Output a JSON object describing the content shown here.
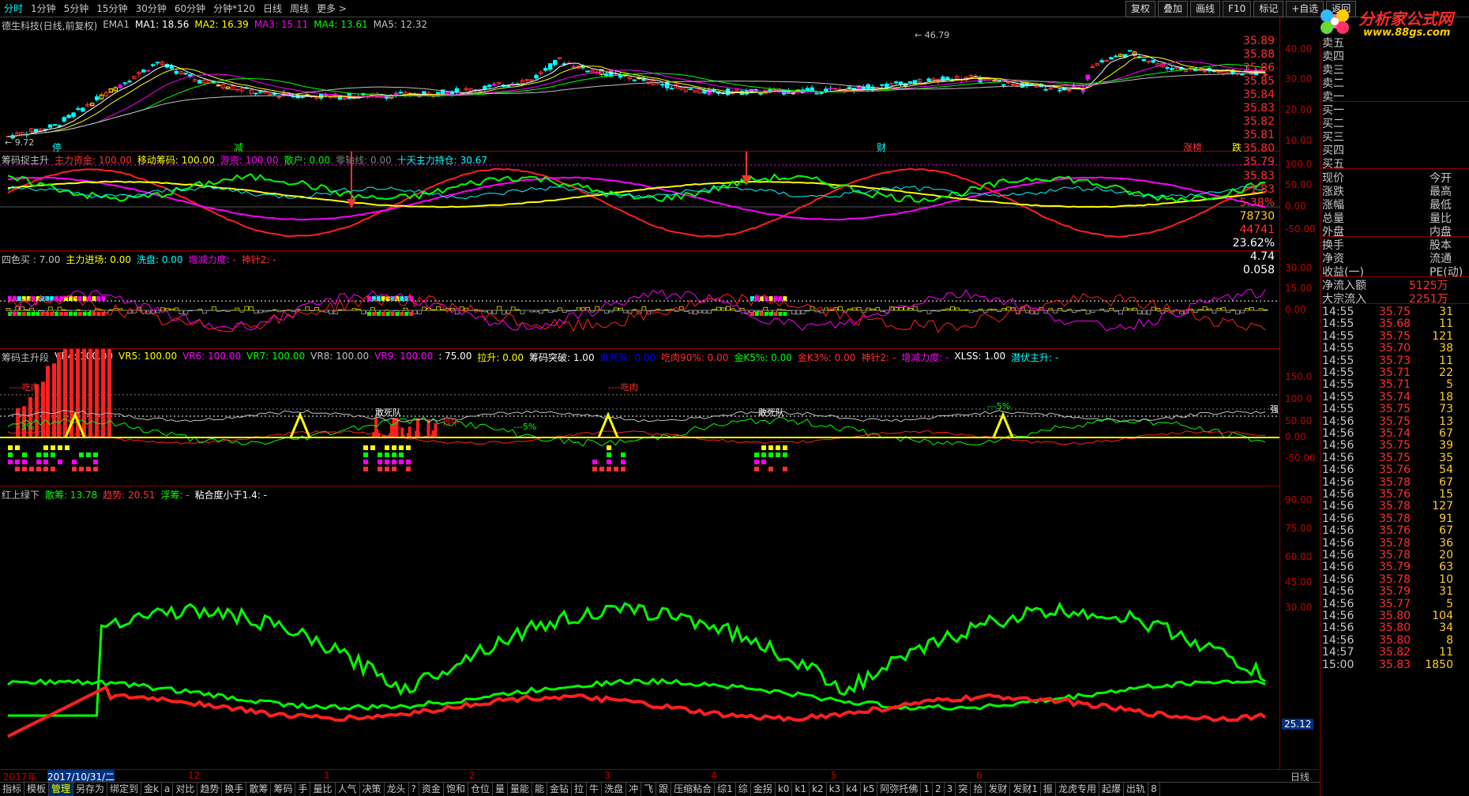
{
  "toolbar": {
    "timeframes": [
      "分时",
      "1分钟",
      "5分钟",
      "15分钟",
      "30分钟",
      "60分钟",
      "分钟*120",
      "日线",
      "周线",
      "更多 >"
    ],
    "buttons": [
      "复权",
      "叠加",
      "画线",
      "F10",
      "标记",
      "+自选",
      "返回"
    ]
  },
  "logo": {
    "text": "分析家公式网",
    "url": "www.88gs.com"
  },
  "pane1": {
    "title": "德生科技(日线,前复权)",
    "items": [
      {
        "t": "EMA1",
        "c": "#c0c0c0"
      },
      {
        "t": "MA1: 18.56",
        "c": "#ffffff"
      },
      {
        "t": "MA2: 16.39",
        "c": "#ffff00"
      },
      {
        "t": "MA3: 15.11",
        "c": "#ff00ff"
      },
      {
        "t": "MA4: 13.61",
        "c": "#00ff00"
      },
      {
        "t": "MA5: 12.32",
        "c": "#c0c0c0"
      }
    ],
    "ticks": [
      "40.00",
      "30.00",
      "20.00",
      "10.00"
    ],
    "low_label": "← 9.72",
    "high_label": "← 46.79",
    "markers": [
      "停",
      "减",
      "财",
      "涨榜",
      "跌"
    ]
  },
  "pane2": {
    "title": "筹码捉主升",
    "items": [
      {
        "t": "主力资金: 100.00",
        "c": "#ff3030"
      },
      {
        "t": "移动筹码: 100.00",
        "c": "#ffff00"
      },
      {
        "t": "游资: 100.00",
        "c": "#ff00ff"
      },
      {
        "t": "散户: 0.00",
        "c": "#00ff00"
      },
      {
        "t": "零轴线: 0.00",
        "c": "#808080"
      },
      {
        "t": "十天主力持仓: 30.67",
        "c": "#00ffff"
      }
    ],
    "ticks": [
      "100.0",
      "50.00",
      "0.00",
      "-50.00"
    ]
  },
  "pane3": {
    "title": "四色买 : 7.00",
    "items": [
      {
        "t": "主力进场: 0.00",
        "c": "#ffff00"
      },
      {
        "t": "洗盘: 0.00",
        "c": "#00ffff"
      },
      {
        "t": "增减力度: -",
        "c": "#ff00ff"
      },
      {
        "t": "神针2: -",
        "c": "#ff3030"
      }
    ],
    "ticks": [
      "30.00",
      "15.00",
      "0.00"
    ]
  },
  "pane4": {
    "title": "筹码主升段",
    "items": [
      {
        "t": "VR4: 100.00",
        "c": "#ffffff"
      },
      {
        "t": "VR5: 100.00",
        "c": "#ffff00"
      },
      {
        "t": "VR6: 100.00",
        "c": "#ff00ff"
      },
      {
        "t": "VR7: 100.00",
        "c": "#00ff00"
      },
      {
        "t": "VR8: 100.00",
        "c": "#c0c0c0"
      },
      {
        "t": "VR9: 100.00",
        "c": "#ff00ff"
      },
      {
        "t": ": 75.00",
        "c": "#ffffff"
      },
      {
        "t": "拉升: 0.00",
        "c": "#ffff00"
      },
      {
        "t": "筹码突破: 1.00",
        "c": "#ffffff"
      },
      {
        "t": "敢死队: 0.00",
        "c": "#0000ff"
      },
      {
        "t": "吃肉90%: 0.00",
        "c": "#ff3030"
      },
      {
        "t": "金K5%: 0.00",
        "c": "#00ff00"
      },
      {
        "t": "金K3%: 0.00",
        "c": "#ff3030"
      },
      {
        "t": "神针2: -",
        "c": "#ff3030"
      },
      {
        "t": "增减力度: -",
        "c": "#ff00ff"
      },
      {
        "t": "XLSS: 1.00",
        "c": "#ffffff"
      },
      {
        "t": "潜伏主升: -",
        "c": "#00ffff"
      }
    ],
    "ticks": [
      "150.0",
      "100.0",
      "50.00",
      "0.00",
      "-50.00"
    ],
    "labels": [
      "----吃肉",
      "----吃肉",
      "敢死队",
      "敢死队",
      "抄牛",
      "---5%",
      "-3%",
      "---5%"
    ],
    "strong": "强"
  },
  "pane5": {
    "title": "红上绿下",
    "items": [
      {
        "t": "散筹: 13.78",
        "c": "#00ff00"
      },
      {
        "t": "趋势: 20.51",
        "c": "#ff3030"
      },
      {
        "t": "浮筹: -",
        "c": "#00ff00"
      },
      {
        "t": "粘合度小于1.4: -",
        "c": "#ffffff"
      }
    ],
    "ticks": [
      "90.00",
      "75.00",
      "60.00",
      "45.00",
      "30.00"
    ],
    "cursor_value": "25.12"
  },
  "datebar": {
    "labels": [
      "2017年",
      "2017/10/31/二",
      "12",
      "1",
      "2",
      "3",
      "4",
      "5",
      "6"
    ],
    "period": "日线"
  },
  "quote": {
    "asks": [
      {
        "l": "卖五",
        "p": "35.89"
      },
      {
        "l": "卖四",
        "p": "35.88"
      },
      {
        "l": "卖三",
        "p": "35.86"
      },
      {
        "l": "卖二",
        "p": "35.85"
      },
      {
        "l": "卖一",
        "p": "35.84"
      }
    ],
    "bids": [
      {
        "l": "买一",
        "p": "35.83"
      },
      {
        "l": "买二",
        "p": "35.82"
      },
      {
        "l": "买三",
        "p": "35.81"
      },
      {
        "l": "买四",
        "p": "35.80"
      },
      {
        "l": "买五",
        "p": "35.79"
      }
    ],
    "stats": [
      {
        "l": "现价",
        "v": "35.83",
        "c": "#ff3030",
        "r": "今开"
      },
      {
        "l": "涨跌",
        "v": "1.83",
        "c": "#ff3030",
        "r": "最高"
      },
      {
        "l": "涨幅",
        "v": "5.38%",
        "c": "#ff3030",
        "r": "最低"
      },
      {
        "l": "总量",
        "v": "78730",
        "c": "#ffcc33",
        "r": "量比"
      },
      {
        "l": "外盘",
        "v": "44741",
        "c": "#ff3030",
        "r": "内盘"
      }
    ],
    "stats2": [
      {
        "l": "换手",
        "v": "23.62%",
        "r": "股本"
      },
      {
        "l": "净资",
        "v": "4.74",
        "r": "流通"
      },
      {
        "l": "收益(一)",
        "v": "0.058",
        "r": "PE(动)"
      }
    ],
    "flows": [
      {
        "l": "净流入额",
        "v": "5125万"
      },
      {
        "l": "大宗流入",
        "v": "2251万"
      }
    ]
  },
  "ticks_list": [
    {
      "t": "14:55",
      "p": "35.75",
      "v": "31"
    },
    {
      "t": "14:55",
      "p": "35.68",
      "v": "11"
    },
    {
      "t": "14:55",
      "p": "35.75",
      "v": "121"
    },
    {
      "t": "14:55",
      "p": "35.70",
      "v": "38"
    },
    {
      "t": "14:55",
      "p": "35.73",
      "v": "11"
    },
    {
      "t": "14:55",
      "p": "35.71",
      "v": "22"
    },
    {
      "t": "14:55",
      "p": "35.71",
      "v": "5"
    },
    {
      "t": "14:55",
      "p": "35.74",
      "v": "18"
    },
    {
      "t": "14:55",
      "p": "35.75",
      "v": "73"
    },
    {
      "t": "14:56",
      "p": "35.75",
      "v": "13"
    },
    {
      "t": "14:56",
      "p": "35.74",
      "v": "67"
    },
    {
      "t": "14:56",
      "p": "35.75",
      "v": "39"
    },
    {
      "t": "14:56",
      "p": "35.75",
      "v": "35"
    },
    {
      "t": "14:56",
      "p": "35.76",
      "v": "54"
    },
    {
      "t": "14:56",
      "p": "35.78",
      "v": "67"
    },
    {
      "t": "14:56",
      "p": "35.76",
      "v": "15"
    },
    {
      "t": "14:56",
      "p": "35.78",
      "v": "127"
    },
    {
      "t": "14:56",
      "p": "35.78",
      "v": "91"
    },
    {
      "t": "14:56",
      "p": "35.76",
      "v": "67"
    },
    {
      "t": "14:56",
      "p": "35.78",
      "v": "36"
    },
    {
      "t": "14:56",
      "p": "35.78",
      "v": "20"
    },
    {
      "t": "14:56",
      "p": "35.79",
      "v": "63"
    },
    {
      "t": "14:56",
      "p": "35.78",
      "v": "10"
    },
    {
      "t": "14:56",
      "p": "35.79",
      "v": "31"
    },
    {
      "t": "14:56",
      "p": "35.77",
      "v": "5"
    },
    {
      "t": "14:56",
      "p": "35.80",
      "v": "104"
    },
    {
      "t": "14:56",
      "p": "35.80",
      "v": "34"
    },
    {
      "t": "14:56",
      "p": "35.80",
      "v": "8"
    },
    {
      "t": "14:57",
      "p": "35.82",
      "v": "11"
    },
    {
      "t": "15:00",
      "p": "35.83",
      "v": "1850"
    }
  ],
  "tabs": [
    "指标",
    "模板",
    "管理",
    "另存为",
    "绑定到",
    "金k",
    "a",
    "对比",
    "趋势",
    "换手",
    "散筹",
    "筹码",
    "手",
    "量比",
    "人气",
    "决策",
    "龙头",
    "?",
    "资金",
    "饱和",
    "仓位",
    "量",
    "量能",
    "能",
    "金钻",
    "拉",
    "牛",
    "洗盘",
    "冲",
    "飞",
    "跟",
    "压缩粘合",
    "综1",
    "综",
    "金拐",
    "k0",
    "k1",
    "k2",
    "k3",
    "k4",
    "k5",
    "阿弥托佛",
    "1",
    "2",
    "3",
    "突",
    "拾",
    "发财",
    "发财1",
    "振",
    "龙虎专用",
    "起爆",
    "出轨",
    "8"
  ],
  "active_tab": "管理"
}
